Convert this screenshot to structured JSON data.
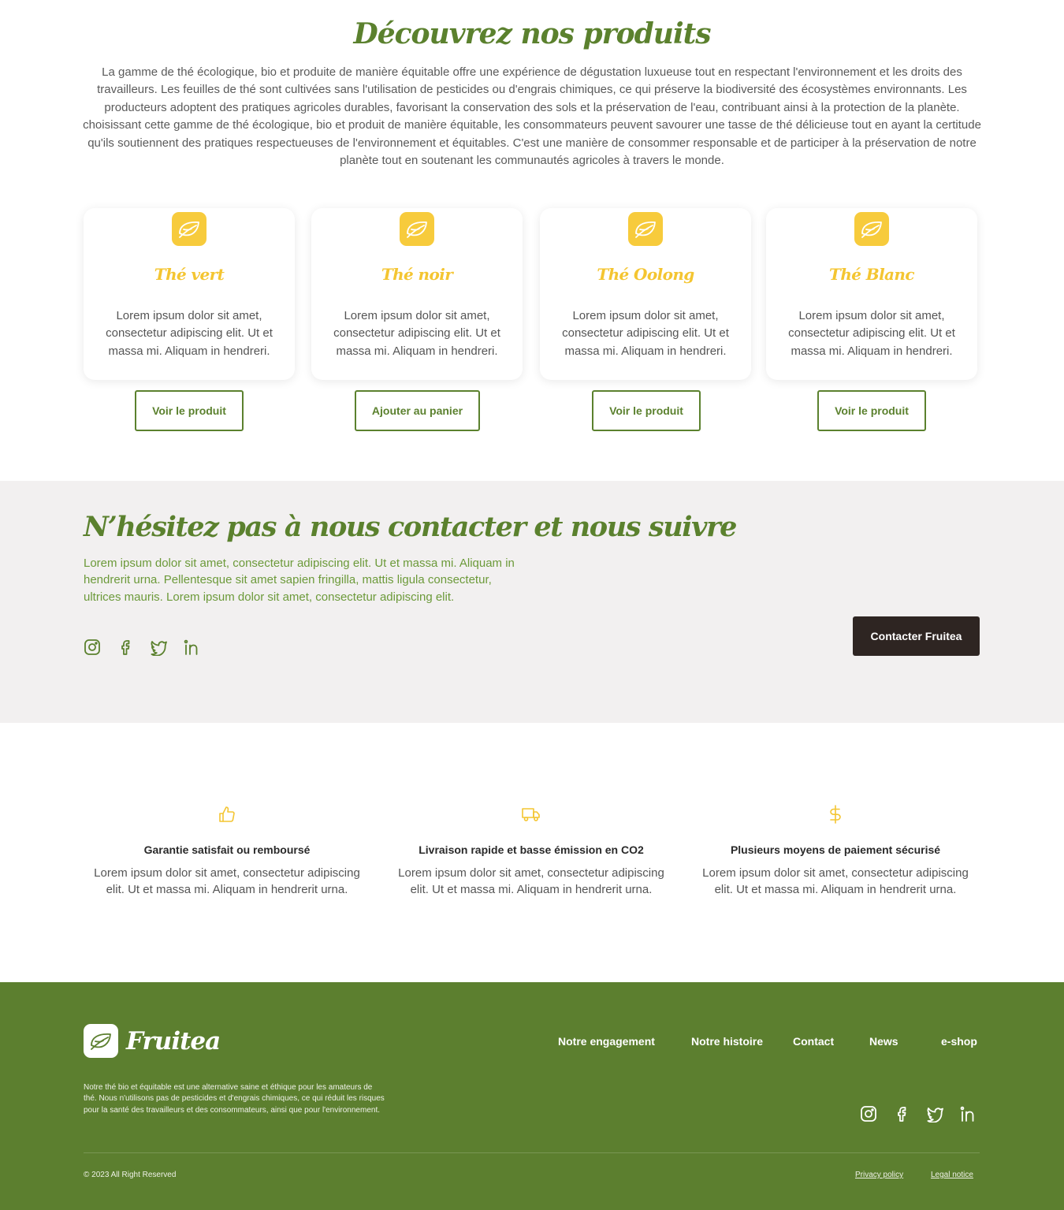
{
  "products": {
    "title": "Découvrez nos produits",
    "intro_p1": "La gamme de thé écologique, bio et produite de manière équitable offre une expérience de dégustation luxueuse tout en respectant l'environnement et les droits des travailleurs. Les feuilles de thé sont cultivées sans l'utilisation de pesticides ou d'engrais chimiques, ce qui préserve la biodiversité des écosystèmes environnants. Les producteurs adoptent des pratiques agricoles durables, favorisant la conservation des sols et la préservation de l'eau, contribuant ainsi à la protection de la planète.",
    "intro_p2": "choisissant cette gamme de thé écologique, bio et produit de manière équitable, les consommateurs peuvent savourer une tasse de thé délicieuse tout en ayant la certitude qu'ils soutiennent des pratiques respectueuses de l'environnement et équitables. C'est une manière de consommer responsable et de participer à la préservation de notre planète tout en soutenant les communautés agricoles à travers le monde.",
    "cards": [
      {
        "icon": "leaf-icon",
        "title": "Thé vert",
        "text": "Lorem ipsum dolor sit amet, consectetur adipiscing elit. Ut et massa mi. Aliquam in hendreri.",
        "button": "Voir le produit"
      },
      {
        "icon": "leaf-icon",
        "title": "Thé noir",
        "text": "Lorem ipsum dolor sit amet, consectetur adipiscing elit. Ut et massa mi. Aliquam in hendreri.",
        "button": "Ajouter au panier"
      },
      {
        "icon": "leaf-icon",
        "title": "Thé Oolong",
        "text": "Lorem ipsum dolor sit amet, consectetur adipiscing elit. Ut et massa mi. Aliquam in hendreri.",
        "button": "Voir le produit"
      },
      {
        "icon": "leaf-icon",
        "title": "Thé Blanc",
        "text": "Lorem ipsum dolor sit amet, consectetur adipiscing elit. Ut et massa mi. Aliquam in hendreri.",
        "button": "Voir le produit"
      }
    ]
  },
  "contact": {
    "title": "N’hésitez pas à nous contacter et nous suivre",
    "text": "Lorem ipsum dolor sit amet, consectetur adipiscing elit. Ut et massa mi. Aliquam in hendrerit urna. Pellentesque sit amet sapien fringilla, mattis ligula consectetur, ultrices mauris. Lorem ipsum dolor sit amet, consectetur adipiscing elit.",
    "socials": [
      "instagram-icon",
      "facebook-icon",
      "twitter-icon",
      "linkedin-icon"
    ],
    "cta": "Contacter Fruitea"
  },
  "features": [
    {
      "icon": "thumbs-up-icon",
      "title": "Garantie satisfait ou remboursé",
      "text": "Lorem ipsum dolor sit amet, consectetur adipiscing elit. Ut et massa mi. Aliquam in hendrerit urna."
    },
    {
      "icon": "truck-icon",
      "title": "Livraison rapide et basse émission en CO2",
      "text": "Lorem ipsum dolor sit amet, consectetur adipiscing elit. Ut et massa mi. Aliquam in hendrerit urna."
    },
    {
      "icon": "dollar-icon",
      "title": "Plusieurs moyens de paiement sécurisé",
      "text": "Lorem ipsum dolor sit amet, consectetur adipiscing elit. Ut et massa mi. Aliquam in hendrerit urna."
    }
  ],
  "footer": {
    "brand": "Fruitea",
    "nav": [
      "Notre engagement",
      "Notre histoire",
      "Contact",
      "News",
      "e-shop"
    ],
    "description": "Notre thé bio et équitable est une alternative saine et éthique pour les amateurs de thé. Nous n'utilisons pas de pesticides et d'engrais chimiques, ce qui réduit les risques pour la santé des travailleurs et des consommateurs, ainsi que pour l'environnement.",
    "socials": [
      "instagram-icon",
      "facebook-icon",
      "twitter-icon",
      "linkedin-icon"
    ],
    "copyright": "© 2023 All Right Reserved",
    "privacy": "Privacy policy",
    "legal": "Legal notice"
  },
  "colors": {
    "brand_green": "#5b812e",
    "accent_yellow": "#f7cb3c",
    "dark_button": "#2e2522",
    "contact_bg": "#f2f0f0",
    "footer_bg": "#5c7f2f"
  }
}
